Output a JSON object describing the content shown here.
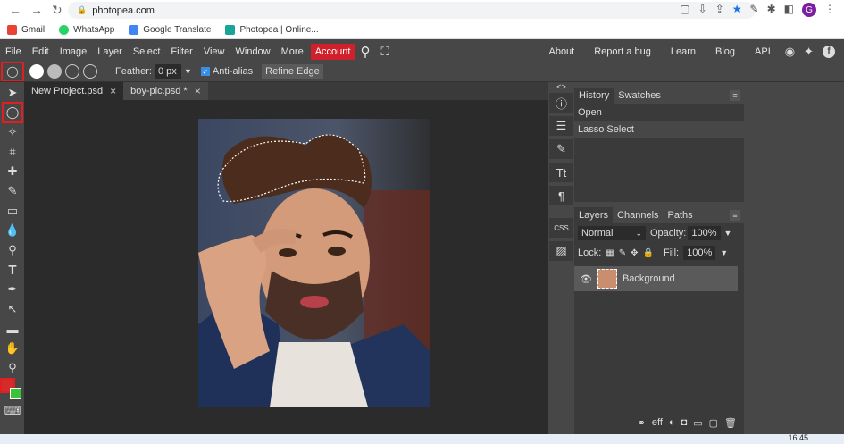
{
  "browser": {
    "url": "photopea.com",
    "nav_back": "←",
    "nav_forward": "→",
    "nav_reload": "↻",
    "profile_initial": "G",
    "bookmarks": [
      {
        "label": "Gmail",
        "color": "#ea4335"
      },
      {
        "label": "WhatsApp",
        "color": "#25d366"
      },
      {
        "label": "Google Translate",
        "color": "#4285f4"
      },
      {
        "label": "Photopea | Online...",
        "color": "#18a497"
      }
    ]
  },
  "menu": {
    "items": [
      "File",
      "Edit",
      "Image",
      "Layer",
      "Select",
      "Filter",
      "View",
      "Window",
      "More"
    ],
    "account": "Account",
    "right_links": [
      "About",
      "Report a bug",
      "Learn",
      "Blog",
      "API"
    ]
  },
  "options": {
    "feather_label": "Feather:",
    "feather_value": "0 px",
    "antialias_label": "Anti-alias",
    "refine_edge": "Refine Edge"
  },
  "tabs": [
    {
      "label": "New Project.psd",
      "close": "×"
    },
    {
      "label": "boy-pic.psd *",
      "close": "×"
    }
  ],
  "history": {
    "tabs": [
      "History",
      "Swatches"
    ],
    "items": [
      "Open",
      "Lasso Select"
    ]
  },
  "layers": {
    "tabs": [
      "Layers",
      "Channels",
      "Paths"
    ],
    "blend_mode": "Normal",
    "opacity_label": "Opacity:",
    "opacity_value": "100%",
    "lock_label": "Lock:",
    "fill_label": "Fill:",
    "fill_value": "100%",
    "items": [
      {
        "name": "Background"
      }
    ]
  },
  "taskbar": {
    "clock": "16:45"
  }
}
